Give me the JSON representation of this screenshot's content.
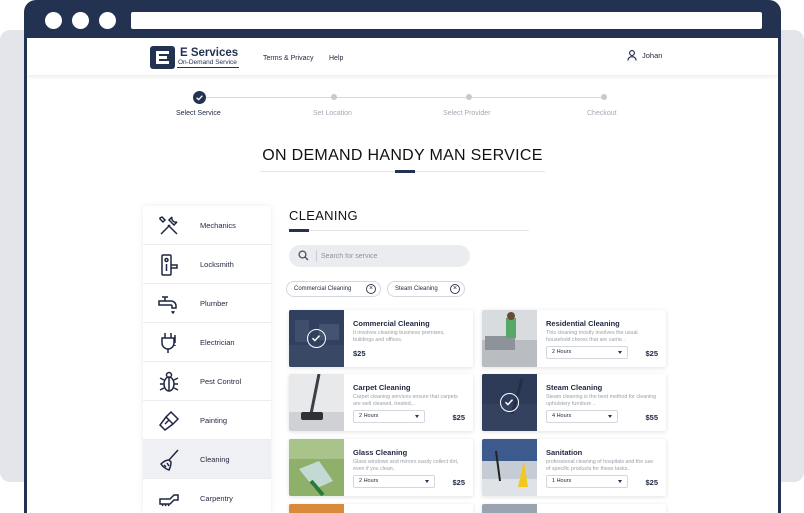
{
  "brand": {
    "name": "E Services",
    "subtitle": "On-Demand Service"
  },
  "nav": {
    "terms": "Terms & Privacy",
    "help": "Help",
    "user_name": "Johan"
  },
  "steps": [
    {
      "label": "Select Service",
      "state": "done"
    },
    {
      "label": "Set Location",
      "state": "pending"
    },
    {
      "label": "Select Provider",
      "state": "pending"
    },
    {
      "label": "Checkout",
      "state": "pending"
    }
  ],
  "page_title": "ON DEMAND HANDY MAN SERVICE",
  "sidebar": {
    "items": [
      {
        "label": "Mechanics",
        "icon": "wrench-screwdriver-icon"
      },
      {
        "label": "Locksmith",
        "icon": "door-lock-icon"
      },
      {
        "label": "Plumber",
        "icon": "faucet-icon"
      },
      {
        "label": "Electrician",
        "icon": "plug-icon"
      },
      {
        "label": "Pest Control",
        "icon": "bug-icon"
      },
      {
        "label": "Painting",
        "icon": "paint-brush-icon"
      },
      {
        "label": "Cleaning",
        "icon": "broom-icon",
        "active": true
      },
      {
        "label": "Carpentry",
        "icon": "saw-icon"
      }
    ]
  },
  "section": {
    "title": "CLEANING"
  },
  "search": {
    "placeholder": "Search for service",
    "value": ""
  },
  "filters": [
    {
      "label": "Commercial Cleaning"
    },
    {
      "label": "Steam Cleaning"
    }
  ],
  "services": [
    {
      "name": "Commercial Cleaning",
      "desc": "It involves cleaning business premises, buildings and offices.",
      "price": "$25",
      "selected": true,
      "image": "office-cleaning-photo"
    },
    {
      "name": "Residential Cleaning",
      "desc": "This cleaning mostly involves the usual household chores that are carrie..",
      "hours": "2 Hours",
      "price": "$25",
      "image": "living-room-cleaning-photo"
    },
    {
      "name": "Carpet Cleaning",
      "desc": "Carpet cleaning services ensure that carpets are well cleaned, treated,..",
      "hours": "2 Hours",
      "price": "$25",
      "image": "vacuum-carpet-photo"
    },
    {
      "name": "Steam Cleaning",
      "desc": "Steam cleaning is the best method for cleaning upholstery furniture ..",
      "hours": "4 Hours",
      "price": "$55",
      "selected": true,
      "image": "steam-cleaning-photo"
    },
    {
      "name": "Glass Cleaning",
      "desc": "Glass windows and mirrors easily collect dirt, even if you clean..",
      "hours": "2 Hours",
      "price": "$25",
      "image": "window-squeegee-photo"
    },
    {
      "name": "Sanitation",
      "desc": "professional cleaning of hospitals and the use of specific products for these tasks..",
      "hours": "1 Hours",
      "price": "$25",
      "image": "mopping-floor-photo"
    }
  ],
  "colors": {
    "primary": "#243252",
    "background": "#e3e5ea"
  }
}
